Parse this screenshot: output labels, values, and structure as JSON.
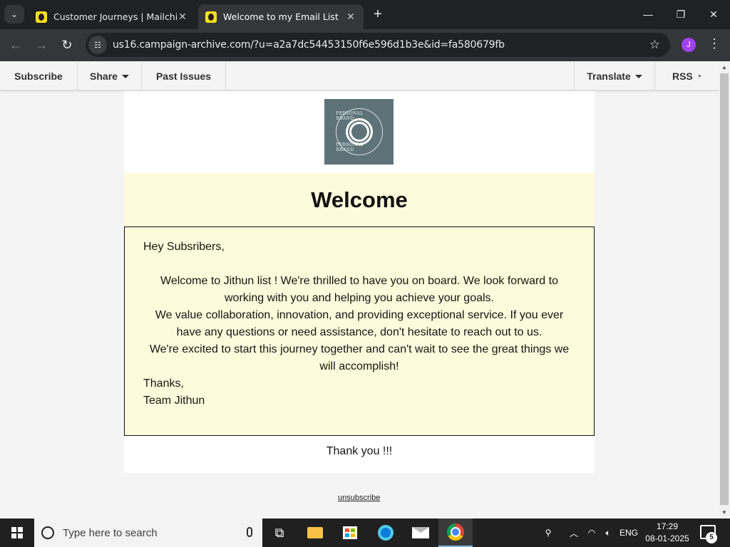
{
  "browser": {
    "tabs": [
      {
        "title": "Customer Journeys | Mailchimp",
        "active": false
      },
      {
        "title": "Welcome to my Email List",
        "active": true
      }
    ],
    "url": "us16.campaign-archive.com/?u=a2a7dc54453150f6e596d1b3e&id=fa580679fb",
    "profile_initial": "J",
    "icons": {
      "tab_search": "chevron-down-icon",
      "new_tab": "plus-icon",
      "minimize": "minimize-icon",
      "restore": "restore-icon",
      "close": "close-icon",
      "back": "arrow-left-icon",
      "forward": "arrow-right-icon",
      "reload": "reload-icon",
      "site_info": "tune-icon",
      "bookmark": "star-icon",
      "menu": "kebab-icon"
    }
  },
  "campaign_nav": {
    "subscribe": "Subscribe",
    "share": "Share",
    "past_issues": "Past Issues",
    "translate": "Translate",
    "rss": "RSS"
  },
  "email": {
    "logo_text_top": "PERSONAL BRAND",
    "logo_text_bottom": "PERSONAL BRAND",
    "title": "Welcome",
    "greeting": "Hey Subsribers,",
    "paragraphs": [
      "Welcome to Jithun list ! We're thrilled to have you on board. We look forward to working with you and helping you achieve your goals.",
      "We value collaboration, innovation, and providing exceptional service. If you ever have any questions or need assistance, don't hesitate to reach out to us.",
      "We're excited to start this journey together and can't wait to see the great things we will accomplish!"
    ],
    "closing": "Thanks,",
    "signature": "Team Jithun",
    "thank_you": "Thank you !!!",
    "unsubscribe": "unsubscribe",
    "colors": {
      "band": "#fdfbdb",
      "logo_bg": "#5e7378",
      "page_bg": "#f4f4f4"
    }
  },
  "taskbar": {
    "search_placeholder": "Type here to search",
    "language": "ENG",
    "time": "17:29",
    "date": "08-01-2025",
    "notification_count": "5"
  }
}
